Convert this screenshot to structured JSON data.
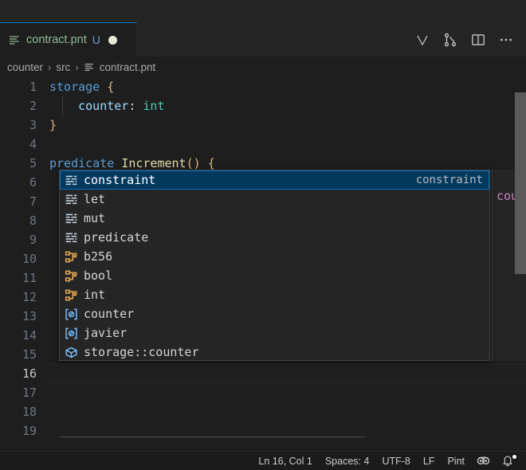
{
  "window": {
    "background": "#1e1e1e",
    "accent": "#0a7aca"
  },
  "tab": {
    "icon": "file-lines-icon",
    "label": "contract.pnt",
    "badge": "U",
    "dirty_indicator": "dirty-dot",
    "actions": [
      {
        "name": "pint-logo-icon",
        "glyph": "V"
      },
      {
        "name": "source-control-icon",
        "glyph": "branch"
      },
      {
        "name": "split-editor-icon",
        "glyph": "split"
      },
      {
        "name": "more-actions-icon",
        "glyph": "..."
      }
    ]
  },
  "breadcrumb": {
    "separator": "›",
    "items": [
      {
        "label": "counter",
        "icon": null
      },
      {
        "label": "src",
        "icon": null
      },
      {
        "label": "contract.pnt",
        "icon": "file-lines-icon"
      }
    ]
  },
  "editor": {
    "lines": [
      {
        "num": "1",
        "tokens": [
          {
            "t": "storage",
            "c": "t-kw"
          },
          {
            "t": " ",
            "c": "t-punc"
          },
          {
            "t": "{",
            "c": "t-brace"
          }
        ],
        "indent_guide": false,
        "active": false
      },
      {
        "num": "2",
        "tokens": [
          {
            "t": "    ",
            "c": "t-punc"
          },
          {
            "t": "counter",
            "c": "t-prop"
          },
          {
            "t": ": ",
            "c": "t-punc"
          },
          {
            "t": "int",
            "c": "t-type"
          }
        ],
        "indent_guide": true,
        "active": false
      },
      {
        "num": "3",
        "tokens": [
          {
            "t": "}",
            "c": "t-brace"
          }
        ],
        "indent_guide": false,
        "active": false
      },
      {
        "num": "4",
        "tokens": [],
        "indent_guide": false,
        "active": false
      },
      {
        "num": "5",
        "tokens": [
          {
            "t": "predicate",
            "c": "t-kw"
          },
          {
            "t": " ",
            "c": "t-punc"
          },
          {
            "t": "Increment",
            "c": "t-fn"
          },
          {
            "t": "()",
            "c": "t-paren"
          },
          {
            "t": " ",
            "c": "t-punc"
          },
          {
            "t": "{",
            "c": "t-brace"
          }
        ],
        "indent_guide": false,
        "active": false
      },
      {
        "num": "6",
        "tokens": [],
        "indent_guide": false,
        "active": false
      },
      {
        "num": "7",
        "tokens": [],
        "indent_guide": false,
        "active": false
      },
      {
        "num": "8",
        "tokens": [],
        "indent_guide": false,
        "active": false
      },
      {
        "num": "9",
        "tokens": [],
        "indent_guide": false,
        "active": false
      },
      {
        "num": "10",
        "tokens": [],
        "indent_guide": false,
        "active": false
      },
      {
        "num": "11",
        "tokens": [],
        "indent_guide": false,
        "active": false
      },
      {
        "num": "12",
        "tokens": [],
        "indent_guide": false,
        "active": false
      },
      {
        "num": "13",
        "tokens": [],
        "indent_guide": false,
        "active": false
      },
      {
        "num": "14",
        "tokens": [],
        "indent_guide": false,
        "active": false
      },
      {
        "num": "15",
        "tokens": [],
        "indent_guide": false,
        "active": false
      },
      {
        "num": "16",
        "tokens": [],
        "indent_guide": false,
        "active": true
      },
      {
        "num": "17",
        "tokens": [],
        "indent_guide": false,
        "active": false
      },
      {
        "num": "18",
        "tokens": [],
        "indent_guide": false,
        "active": false
      },
      {
        "num": "19",
        "tokens": [],
        "indent_guide": false,
        "active": false
      }
    ]
  },
  "doc_panel": {
    "text": "cou"
  },
  "suggest": {
    "selected_index": 0,
    "items": [
      {
        "label": "constraint",
        "detail": "constraint",
        "icon": "keyword-icon"
      },
      {
        "label": "let",
        "detail": "",
        "icon": "keyword-icon"
      },
      {
        "label": "mut",
        "detail": "",
        "icon": "keyword-icon"
      },
      {
        "label": "predicate",
        "detail": "",
        "icon": "keyword-icon"
      },
      {
        "label": "b256",
        "detail": "",
        "icon": "struct-icon"
      },
      {
        "label": "bool",
        "detail": "",
        "icon": "struct-icon"
      },
      {
        "label": "int",
        "detail": "",
        "icon": "struct-icon"
      },
      {
        "label": "counter",
        "detail": "",
        "icon": "variable-icon"
      },
      {
        "label": "javier",
        "detail": "",
        "icon": "variable-icon"
      },
      {
        "label": "storage::counter",
        "detail": "",
        "icon": "module-icon"
      }
    ]
  },
  "statusbar": {
    "cursor": "Ln 16, Col 1",
    "indent": "Spaces: 4",
    "encoding": "UTF-8",
    "eol": "LF",
    "language": "Pint",
    "icons": [
      {
        "name": "live-share-icon"
      },
      {
        "name": "notifications-bell-icon"
      }
    ]
  }
}
